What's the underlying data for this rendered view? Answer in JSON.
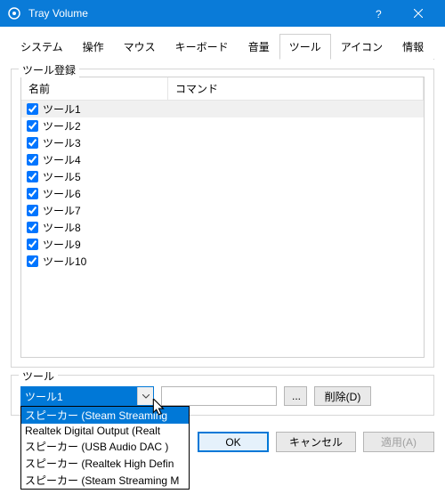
{
  "window": {
    "title": "Tray Volume"
  },
  "tabs": {
    "items": [
      {
        "label": "システム"
      },
      {
        "label": "操作"
      },
      {
        "label": "マウス"
      },
      {
        "label": "キーボード"
      },
      {
        "label": "音量"
      },
      {
        "label": "ツール"
      },
      {
        "label": "アイコン"
      },
      {
        "label": "情報"
      }
    ],
    "active_index": 5
  },
  "tool_register": {
    "legend": "ツール登録",
    "columns": {
      "name": "名前",
      "command": "コマンド"
    },
    "rows": [
      {
        "checked": true,
        "name": "ツール1"
      },
      {
        "checked": true,
        "name": "ツール2"
      },
      {
        "checked": true,
        "name": "ツール3"
      },
      {
        "checked": true,
        "name": "ツール4"
      },
      {
        "checked": true,
        "name": "ツール5"
      },
      {
        "checked": true,
        "name": "ツール6"
      },
      {
        "checked": true,
        "name": "ツール7"
      },
      {
        "checked": true,
        "name": "ツール8"
      },
      {
        "checked": true,
        "name": "ツール9"
      },
      {
        "checked": true,
        "name": "ツール10"
      }
    ]
  },
  "tool_edit": {
    "legend": "ツール",
    "combo_value": "ツール1",
    "dropdown_open": true,
    "dropdown_items": [
      "スピーカー (Steam Streaming ",
      "Realtek Digital Output (Realt",
      "スピーカー (USB Audio DAC   )",
      "スピーカー (Realtek High Defin",
      "スピーカー (Steam Streaming M"
    ],
    "dropdown_highlight": 0,
    "command_value": "",
    "browse_label": "...",
    "delete_label": "削除(D)"
  },
  "buttons": {
    "ok": "OK",
    "cancel": "キャンセル",
    "apply": "適用(A)"
  }
}
